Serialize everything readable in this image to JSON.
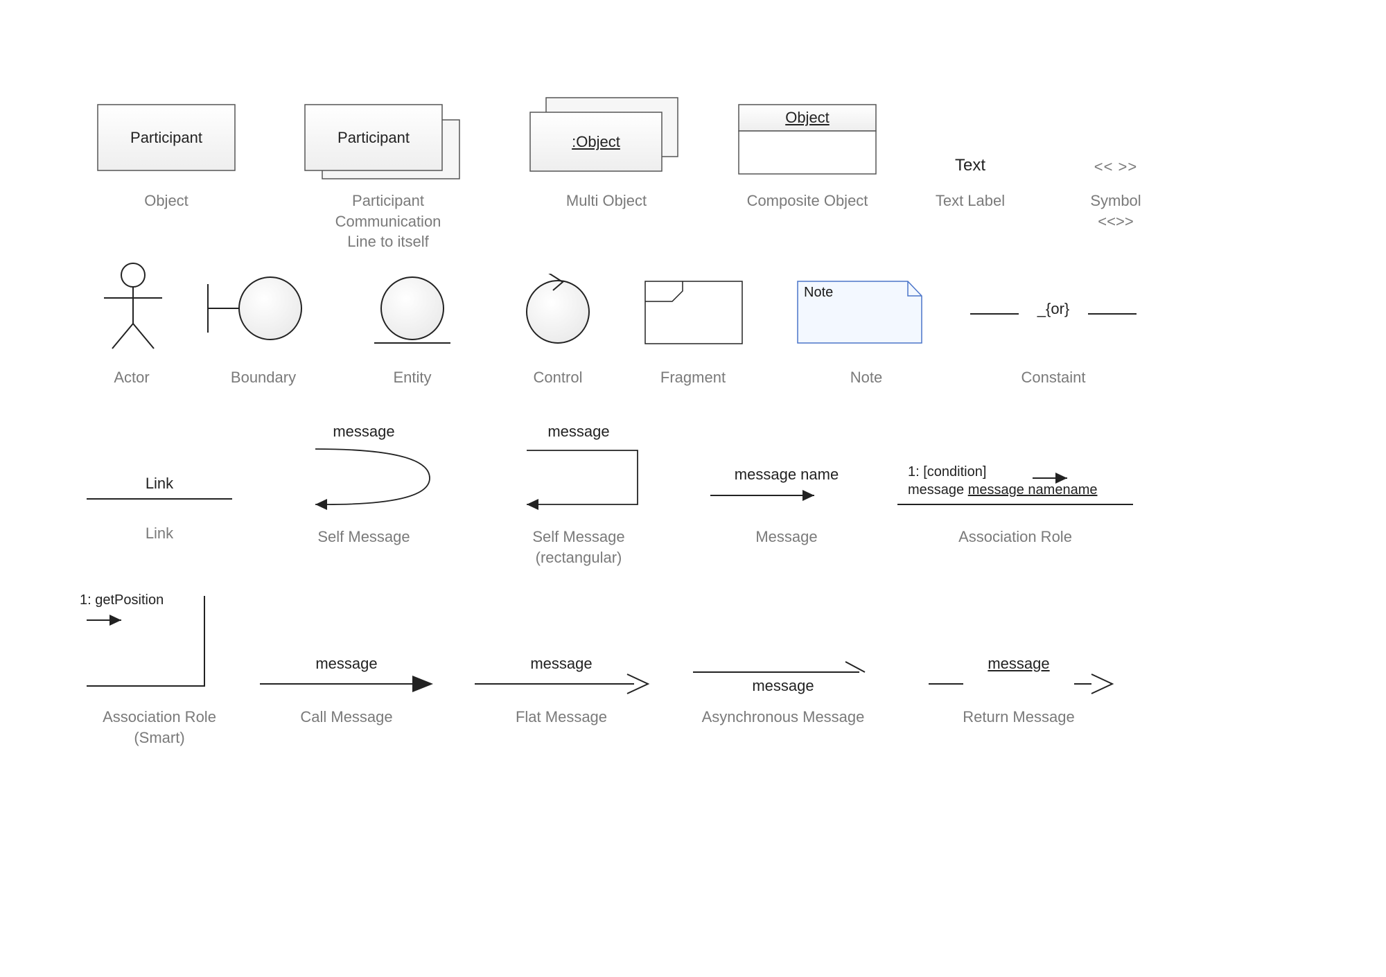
{
  "row1": {
    "object": {
      "shapeText": "Participant",
      "caption": "Object"
    },
    "participantComm": {
      "shapeText": "Participant",
      "caption": "Participant Communication\nLine to itself"
    },
    "multiObject": {
      "shapeText": ":Object",
      "caption": "Multi Object"
    },
    "compositeObject": {
      "shapeText": "Object",
      "caption": "Composite Object"
    },
    "textLabel": {
      "shapeText": "Text",
      "caption": "Text Label"
    },
    "symbol": {
      "shapeText": "<< >>",
      "caption": "Symbol\n<<>>"
    }
  },
  "row2": {
    "actor": {
      "caption": "Actor"
    },
    "boundary": {
      "caption": "Boundary"
    },
    "entity": {
      "caption": "Entity"
    },
    "control": {
      "caption": "Control"
    },
    "fragment": {
      "caption": "Fragment"
    },
    "note": {
      "shapeText": "Note",
      "caption": "Note"
    },
    "constraint": {
      "shapeText": "_{or}",
      "caption": "Constaint"
    }
  },
  "row3": {
    "link": {
      "shapeText": "Link",
      "caption": "Link"
    },
    "selfMessage": {
      "shapeText": "message",
      "caption": "Self Message"
    },
    "selfMessageRect": {
      "shapeText": "message",
      "caption": "Self Message\n(rectangular)"
    },
    "message": {
      "shapeText": "message name",
      "caption": "Message"
    },
    "associationRole": {
      "line1": "1: [condition]",
      "line2": "message name",
      "caption": "Association Role"
    }
  },
  "row4": {
    "associationRoleSmart": {
      "shapeText": "1: getPosition",
      "caption": "Association Role\n(Smart)"
    },
    "callMessage": {
      "shapeText": "message",
      "caption": "Call Message"
    },
    "flatMessage": {
      "shapeText": "message",
      "caption": "Flat Message"
    },
    "asyncMessage": {
      "shapeText": "message",
      "caption": "Asynchronous Message"
    },
    "returnMessage": {
      "shapeText": "message",
      "caption": "Return Message"
    }
  }
}
